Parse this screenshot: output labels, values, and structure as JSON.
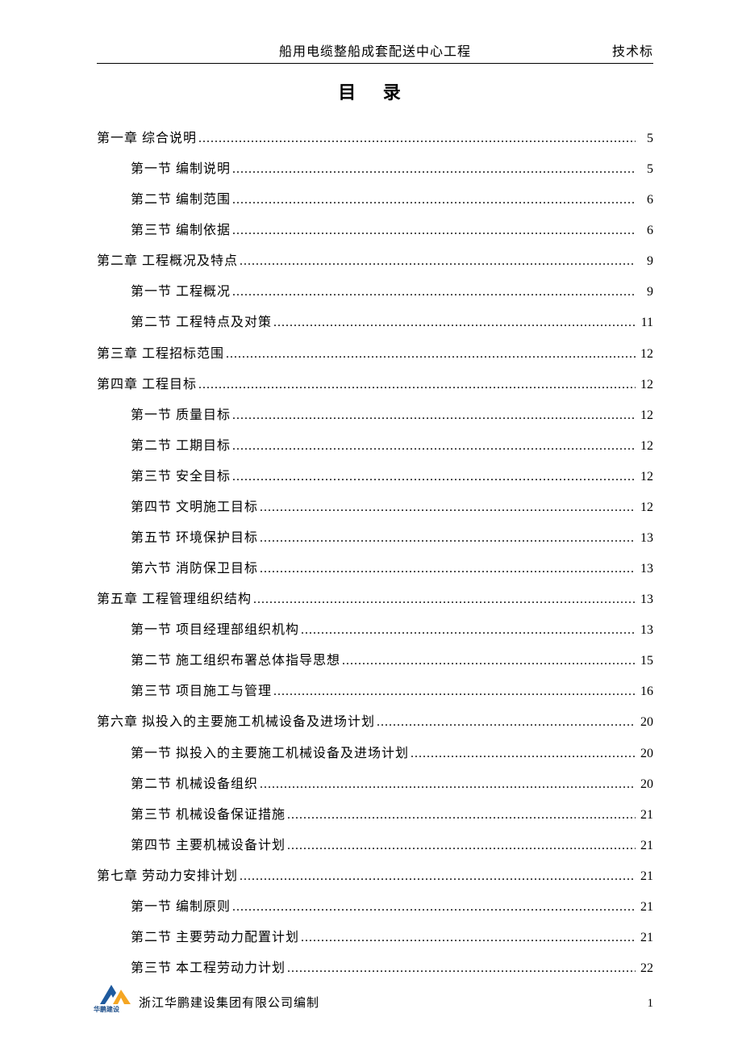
{
  "header": {
    "center": "船用电缆整船成套配送中心工程",
    "right": "技术标"
  },
  "title": "目  录",
  "toc": [
    {
      "level": 1,
      "label": "第一章 综合说明",
      "page": "5"
    },
    {
      "level": 2,
      "label": "第一节 编制说明",
      "page": "5"
    },
    {
      "level": 2,
      "label": "第二节 编制范围",
      "page": "6"
    },
    {
      "level": 2,
      "label": "第三节 编制依据",
      "page": "6"
    },
    {
      "level": 1,
      "label": "第二章 工程概况及特点",
      "page": "9"
    },
    {
      "level": 2,
      "label": "第一节 工程概况",
      "page": "9"
    },
    {
      "level": 2,
      "label": "第二节 工程特点及对策",
      "page": "11"
    },
    {
      "level": 1,
      "label": "第三章 工程招标范围",
      "page": "12"
    },
    {
      "level": 1,
      "label": "第四章 工程目标",
      "page": "12"
    },
    {
      "level": 2,
      "label": "第一节 质量目标",
      "page": "12"
    },
    {
      "level": 2,
      "label": "第二节 工期目标",
      "page": "12"
    },
    {
      "level": 2,
      "label": "第三节 安全目标",
      "page": "12"
    },
    {
      "level": 2,
      "label": "第四节 文明施工目标",
      "page": "12"
    },
    {
      "level": 2,
      "label": "第五节 环境保护目标",
      "page": "13"
    },
    {
      "level": 2,
      "label": "第六节 消防保卫目标",
      "page": "13"
    },
    {
      "level": 1,
      "label": "第五章 工程管理组织结构",
      "page": "13"
    },
    {
      "level": 2,
      "label": "第一节 项目经理部组织机构",
      "page": "13"
    },
    {
      "level": 2,
      "label": "第二节 施工组织布署总体指导思想",
      "page": "15"
    },
    {
      "level": 2,
      "label": "第三节 项目施工与管理",
      "page": "16"
    },
    {
      "level": 1,
      "label": "第六章 拟投入的主要施工机械设备及进场计划",
      "page": "20"
    },
    {
      "level": 2,
      "label": "第一节 拟投入的主要施工机械设备及进场计划",
      "page": "20"
    },
    {
      "level": 2,
      "label": "第二节 机械设备组织",
      "page": "20"
    },
    {
      "level": 2,
      "label": "第三节 机械设备保证措施",
      "page": "21"
    },
    {
      "level": 2,
      "label": "第四节 主要机械设备计划",
      "page": "21"
    },
    {
      "level": 1,
      "label": "第七章 劳动力安排计划",
      "page": "21"
    },
    {
      "level": 2,
      "label": "第一节 编制原则",
      "page": "21"
    },
    {
      "level": 2,
      "label": "第二节 主要劳动力配置计划",
      "page": "21"
    },
    {
      "level": 2,
      "label": "第三节 本工程劳动力计划",
      "page": "22"
    }
  ],
  "footer": {
    "logo_text": "华鹏建设",
    "company": "浙江华鹏建设集团有限公司编制",
    "page_number": "1"
  }
}
